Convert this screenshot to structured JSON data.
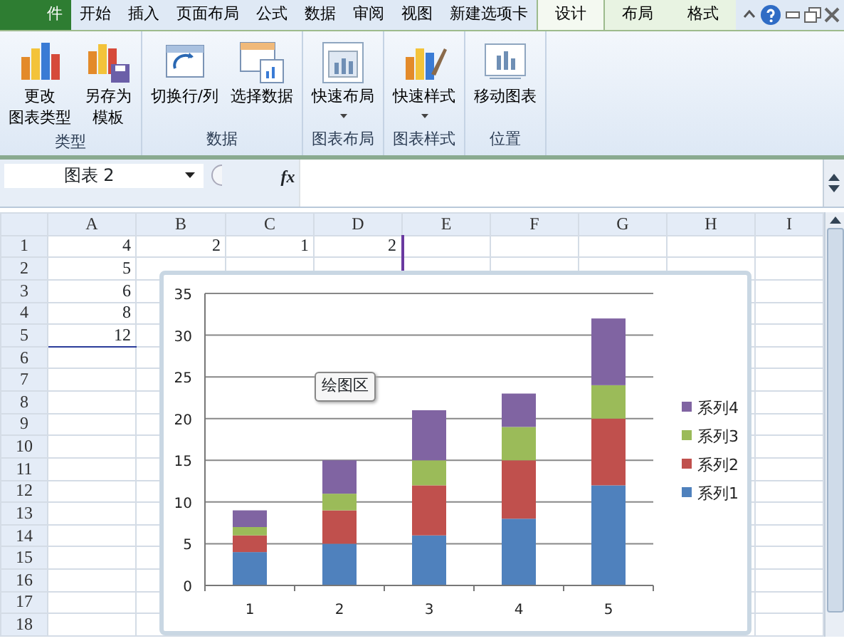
{
  "tabs": [
    {
      "label": "件",
      "kind": "file",
      "selected": false
    },
    {
      "label": "开始",
      "kind": "tab",
      "selected": false
    },
    {
      "label": "插入",
      "kind": "tab",
      "selected": false
    },
    {
      "label": "页面布局",
      "kind": "tab",
      "selected": false
    },
    {
      "label": "公式",
      "kind": "tab",
      "selected": false
    },
    {
      "label": "数据",
      "kind": "tab",
      "selected": false
    },
    {
      "label": "审阅",
      "kind": "tab",
      "selected": false
    },
    {
      "label": "视图",
      "kind": "tab",
      "selected": false
    },
    {
      "label": "新建选项卡",
      "kind": "tab",
      "selected": false
    },
    {
      "label": "设计",
      "kind": "context",
      "selected": true
    },
    {
      "label": "布局",
      "kind": "context",
      "selected": false
    },
    {
      "label": "格式",
      "kind": "context",
      "selected": false
    }
  ],
  "ribbon_groups": [
    {
      "label": "类型",
      "buttons": [
        {
          "lines": [
            "更改",
            "图表类型"
          ],
          "dropdown": false
        },
        {
          "lines": [
            "另存为",
            "模板"
          ],
          "dropdown": false
        }
      ]
    },
    {
      "label": "数据",
      "buttons": [
        {
          "lines": [
            "切换行/列"
          ],
          "dropdown": false
        },
        {
          "lines": [
            "选择数据"
          ],
          "dropdown": false
        }
      ]
    },
    {
      "label": "图表布局",
      "buttons": [
        {
          "lines": [
            "快速布局"
          ],
          "dropdown": true
        }
      ]
    },
    {
      "label": "图表样式",
      "buttons": [
        {
          "lines": [
            "快速样式"
          ],
          "dropdown": true
        }
      ]
    },
    {
      "label": "位置",
      "buttons": [
        {
          "lines": [
            "移动图表"
          ],
          "dropdown": false
        }
      ]
    }
  ],
  "name_box": "图表 2",
  "formula_label": "fx",
  "columns": [
    "A",
    "B",
    "C",
    "D",
    "E",
    "F",
    "G",
    "H",
    "I"
  ],
  "rows": [
    {
      "number": "1",
      "cells": [
        "4",
        "2",
        "1",
        "2"
      ]
    },
    {
      "number": "2",
      "cells": [
        "5"
      ]
    },
    {
      "number": "3",
      "cells": [
        "6"
      ]
    },
    {
      "number": "4",
      "cells": [
        "8"
      ]
    },
    {
      "number": "5",
      "cells": [
        "12"
      ]
    },
    {
      "number": "6",
      "cells": []
    },
    {
      "number": "7",
      "cells": []
    },
    {
      "number": "8",
      "cells": []
    },
    {
      "number": "9",
      "cells": []
    },
    {
      "number": "10",
      "cells": []
    },
    {
      "number": "11",
      "cells": []
    },
    {
      "number": "12",
      "cells": []
    },
    {
      "number": "13",
      "cells": []
    },
    {
      "number": "14",
      "cells": []
    },
    {
      "number": "15",
      "cells": []
    },
    {
      "number": "16",
      "cells": []
    },
    {
      "number": "17",
      "cells": []
    },
    {
      "number": "18",
      "cells": []
    }
  ],
  "chart": {
    "tooltip": "绘图区",
    "chart_data": {
      "type": "bar",
      "stacked": true,
      "orientation": "vertical",
      "categories": [
        "1",
        "2",
        "3",
        "4",
        "5"
      ],
      "series": [
        {
          "name": "系列1",
          "color": "#4f81bd",
          "values": [
            4,
            5,
            6,
            8,
            12
          ]
        },
        {
          "name": "系列2",
          "color": "#c0504d",
          "values": [
            2,
            4,
            6,
            7,
            8
          ]
        },
        {
          "name": "系列3",
          "color": "#9bbb59",
          "values": [
            1,
            2,
            3,
            4,
            4
          ]
        },
        {
          "name": "系列4",
          "color": "#8064a2",
          "values": [
            2,
            4,
            6,
            4,
            8
          ]
        }
      ],
      "grid": true,
      "legend": "right",
      "ylim": [
        0,
        35
      ],
      "yticks": [
        0,
        5,
        10,
        15,
        20,
        25,
        30,
        35
      ]
    }
  }
}
